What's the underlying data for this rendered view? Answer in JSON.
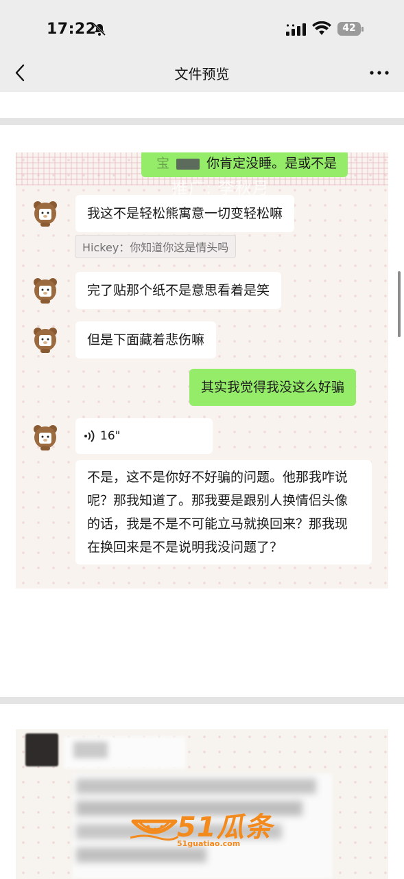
{
  "status_bar": {
    "time": "17:22",
    "battery": "42"
  },
  "nav": {
    "title": "文件预览"
  },
  "chat": {
    "top_message": "你肯定没睡。是或不是",
    "top_message_prefix": "宝",
    "watermark": "推广: 李秋月",
    "messages": [
      {
        "text": "我这不是轻松熊寓意一切变轻松嘛"
      },
      {
        "text": "完了贴那个纸不是意思看着是笑"
      },
      {
        "text": "但是下面藏着悲伤嘛"
      },
      {
        "text": "其实我觉得我没这么好骗"
      },
      {
        "text": "16\""
      },
      {
        "text": "不是，这不是你好不好骗的问题。他那我咋说呢？那我知道了。那我要是跟别人换情侣头像的话，我是不是不可能立马就换回来？那我现在换回来是不是说明我没问题了？"
      }
    ],
    "quote": "Hickey：你知道你这是情头吗"
  },
  "logo": {
    "text": "51瓜条",
    "url": "51guatiao.com"
  },
  "colors": {
    "incoming": "#ffffff",
    "outgoing": "#95ec69",
    "logo": "#f28a1e"
  }
}
